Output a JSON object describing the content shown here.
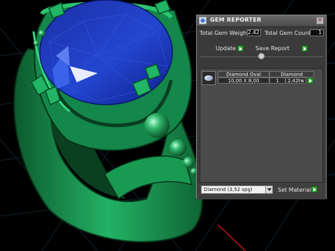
{
  "viewport": {
    "scene_icon": "3d-ring-model",
    "colors": {
      "background": "#000000",
      "ring_metal": "#1fa05a",
      "gem": "#1e3fb8"
    }
  },
  "panel": {
    "title": "GEM REPORTER",
    "title_icon": "gem-reporter-app-icon",
    "close_icon": "close-icon",
    "total_weight_label": "Total Gem Weight",
    "total_weight_value": "2.42",
    "total_count_label": "Total Gem Count",
    "total_count_value": "1",
    "update_label": "Update",
    "save_report_label": "Save Report",
    "table": {
      "headers": [
        "Diamond Oval",
        "Diamond"
      ],
      "rows": [
        {
          "thumb_icon": "oval-diamond-icon",
          "size": "10,00 X 8,00",
          "count": "1",
          "weight": "2,42tw"
        }
      ]
    },
    "material_select": "Diamond      (3,52 spg)",
    "set_material_label": "Set Material"
  }
}
